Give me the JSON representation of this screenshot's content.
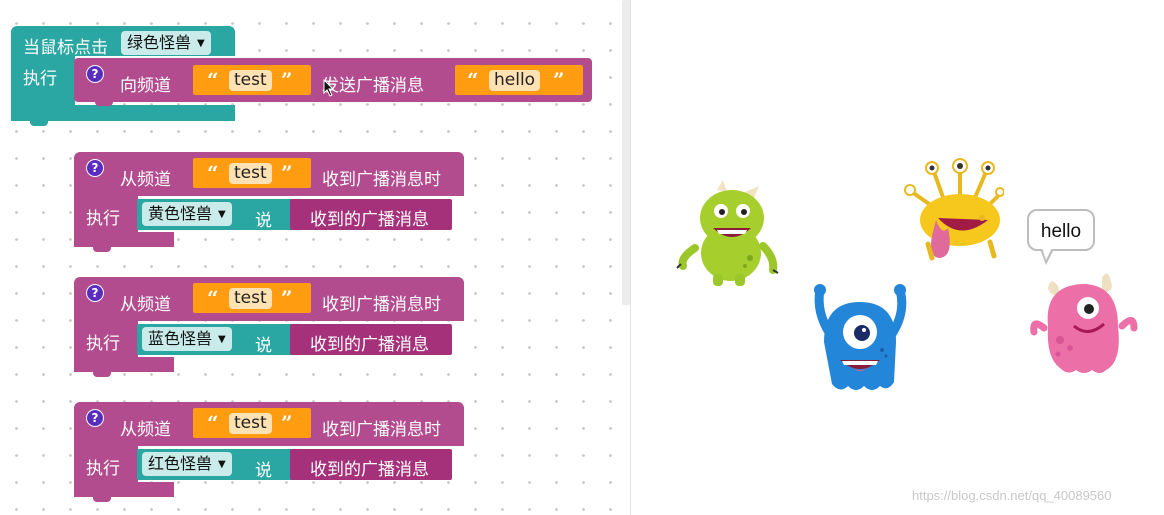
{
  "workspace": {
    "hat_block": {
      "when_label": "当鼠标点击",
      "sprite_dropdown": "绿色怪兽",
      "do_label": "执行",
      "broadcast_to_label": "向频道",
      "channel_value": "test",
      "send_label": "发送广播消息",
      "message_value": "hello"
    },
    "receivers": [
      {
        "from_label": "从频道",
        "channel_value": "test",
        "received_label": "收到广播消息时",
        "do_label": "执行",
        "sprite_dropdown": "黄色怪兽",
        "say_label": "说",
        "received_message_label": "收到的广播消息"
      },
      {
        "from_label": "从频道",
        "channel_value": "test",
        "received_label": "收到广播消息时",
        "do_label": "执行",
        "sprite_dropdown": "蓝色怪兽",
        "say_label": "说",
        "received_message_label": "收到的广播消息"
      },
      {
        "from_label": "从频道",
        "channel_value": "test",
        "received_label": "收到广播消息时",
        "do_label": "执行",
        "sprite_dropdown": "红色怪兽",
        "say_label": "说",
        "received_message_label": "收到的广播消息"
      }
    ],
    "help_icon_glyph": "?",
    "open_quote": "“",
    "close_quote": "”",
    "dropdown_arrow": "▼"
  },
  "stage": {
    "speech_bubble": "hello",
    "sprites": [
      "green-monster-icon",
      "yellow-monster-icon",
      "blue-monster-icon",
      "pink-monster-icon"
    ]
  },
  "watermark": "https://blog.csdn.net/qq_40089560",
  "colors": {
    "event_teal": "#2aa7a3",
    "broadcast_pink": "#b34b8f",
    "reporter_dark_pink": "#a43179",
    "text_orange": "#ff9c10",
    "help_purple": "#5a2dbf"
  }
}
